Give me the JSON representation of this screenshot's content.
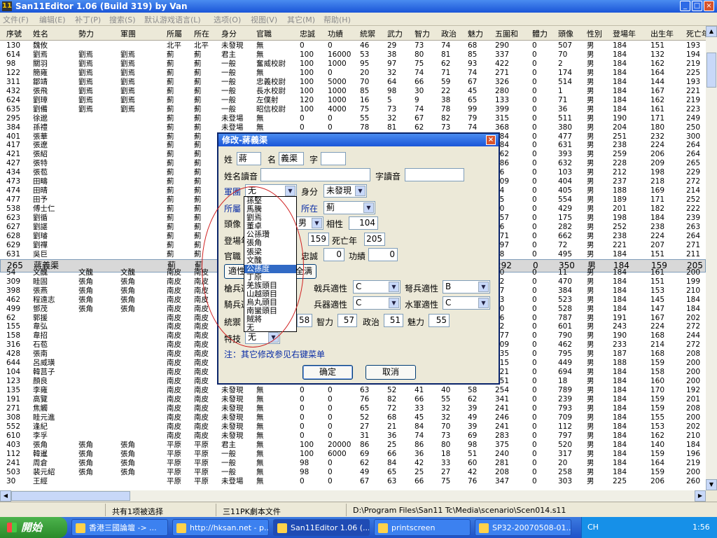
{
  "window": {
    "title": "San11Editor 1.06 (Build 319) by Van",
    "minimize": "_",
    "maximize": "□",
    "close": "×",
    "icon_label": "11"
  },
  "menu": [
    "文件(F)",
    "编辑(E)",
    "补丁(P)",
    "搜索(S)",
    "默认游戏语言(L)",
    "选项(O)",
    "视图(V)",
    "其它(M)",
    "帮助(H)"
  ],
  "grid": {
    "columns": [
      "序號",
      "姓名",
      "勢力",
      "軍團",
      "所屬",
      "所在",
      "身分",
      "官職",
      "忠誠",
      "功績",
      "統禦",
      "武力",
      "智力",
      "政治",
      "魅力",
      "五圍和",
      "體力",
      "頭像",
      "性別",
      "登場年",
      "出生年",
      "死亡年"
    ],
    "rows": [
      [
        "130",
        "魏攸",
        "",
        "",
        "北平",
        "北平",
        "未發現",
        "無",
        "0",
        "0",
        "46",
        "29",
        "73",
        "74",
        "68",
        "290",
        "0",
        "507",
        "男",
        "184",
        "151",
        "193"
      ],
      [
        "614",
        "劉焉",
        "劉焉",
        "劉焉",
        "薊",
        "薊",
        "君主",
        "無",
        "100",
        "16000",
        "53",
        "38",
        "80",
        "81",
        "85",
        "337",
        "0",
        "70",
        "男",
        "184",
        "132",
        "194"
      ],
      [
        "98",
        "關羽",
        "劉焉",
        "劉焉",
        "薊",
        "薊",
        "一般",
        "奮威校尉",
        "100",
        "1000",
        "95",
        "97",
        "75",
        "62",
        "93",
        "422",
        "0",
        "2",
        "男",
        "184",
        "162",
        "219"
      ],
      [
        "122",
        "簡雍",
        "劉焉",
        "劉焉",
        "薊",
        "薊",
        "一般",
        "無",
        "100",
        "0",
        "20",
        "32",
        "74",
        "71",
        "74",
        "271",
        "0",
        "174",
        "男",
        "184",
        "164",
        "225"
      ],
      [
        "311",
        "鄒靖",
        "劉焉",
        "劉焉",
        "薊",
        "薊",
        "一般",
        "忠義校尉",
        "100",
        "5000",
        "70",
        "64",
        "66",
        "59",
        "67",
        "326",
        "0",
        "514",
        "男",
        "184",
        "144",
        "193"
      ],
      [
        "432",
        "張飛",
        "劉焉",
        "劉焉",
        "薊",
        "薊",
        "一般",
        "長水校尉",
        "100",
        "1000",
        "85",
        "98",
        "30",
        "22",
        "45",
        "280",
        "0",
        "1",
        "男",
        "184",
        "167",
        "221"
      ],
      [
        "624",
        "劉璋",
        "劉焉",
        "劉焉",
        "薊",
        "薊",
        "一般",
        "左僕射",
        "120",
        "1000",
        "16",
        "5",
        "9",
        "38",
        "65",
        "133",
        "0",
        "71",
        "男",
        "184",
        "162",
        "219"
      ],
      [
        "635",
        "劉備",
        "劉焉",
        "劉焉",
        "薊",
        "薊",
        "一般",
        "昭信校尉",
        "100",
        "4000",
        "75",
        "73",
        "74",
        "78",
        "99",
        "399",
        "0",
        "36",
        "男",
        "184",
        "161",
        "223"
      ],
      [
        "295",
        "徐邈",
        "",
        "",
        "薊",
        "薊",
        "未登場",
        "無",
        "0",
        "0",
        "55",
        "32",
        "67",
        "82",
        "79",
        "315",
        "0",
        "511",
        "男",
        "190",
        "171",
        "249"
      ],
      [
        "384",
        "孫禮",
        "",
        "",
        "薊",
        "薊",
        "未登場",
        "無",
        "0",
        "0",
        "78",
        "81",
        "62",
        "73",
        "74",
        "368",
        "0",
        "380",
        "男",
        "204",
        "180",
        "250"
      ],
      [
        "401",
        "張華",
        "",
        "",
        "薊",
        "薊",
        "",
        "",
        "",
        "",
        "",
        "",
        "",
        "",
        "",
        "184",
        "0",
        "477",
        "男",
        "251",
        "232",
        "300"
      ],
      [
        "417",
        "張遼",
        "",
        "",
        "薊",
        "薊",
        "",
        "",
        "",
        "",
        "",
        "",
        "",
        "",
        "",
        "184",
        "0",
        "631",
        "男",
        "238",
        "224",
        "264"
      ],
      [
        "421",
        "張紹",
        "",
        "",
        "薊",
        "薊",
        "",
        "",
        "",
        "",
        "",
        "",
        "",
        "",
        "",
        "162",
        "0",
        "393",
        "男",
        "259",
        "206",
        "264"
      ],
      [
        "427",
        "張特",
        "",
        "",
        "薊",
        "薊",
        "",
        "",
        "",
        "",
        "",
        "",
        "",
        "",
        "",
        "186",
        "0",
        "632",
        "男",
        "228",
        "209",
        "265"
      ],
      [
        "434",
        "張苞",
        "",
        "",
        "薊",
        "薊",
        "",
        "",
        "",
        "",
        "",
        "",
        "",
        "",
        "",
        "36",
        "0",
        "103",
        "男",
        "212",
        "198",
        "229"
      ],
      [
        "473",
        "田疇",
        "",
        "",
        "薊",
        "薊",
        "",
        "",
        "",
        "",
        "",
        "",
        "",
        "",
        "",
        "309",
        "0",
        "404",
        "男",
        "237",
        "218",
        "272"
      ],
      [
        "474",
        "田晴",
        "",
        "",
        "薊",
        "薊",
        "",
        "",
        "",
        "",
        "",
        "",
        "",
        "",
        "",
        "64",
        "0",
        "405",
        "男",
        "188",
        "169",
        "214"
      ],
      [
        "477",
        "田予",
        "",
        "",
        "薊",
        "薊",
        "",
        "",
        "",
        "",
        "",
        "",
        "",
        "",
        "",
        "55",
        "0",
        "554",
        "男",
        "189",
        "171",
        "252"
      ],
      [
        "538",
        "傅士仁",
        "",
        "",
        "薊",
        "薊",
        "",
        "",
        "",
        "",
        "",
        "",
        "",
        "",
        "",
        "90",
        "0",
        "429",
        "男",
        "201",
        "182",
        "222"
      ],
      [
        "623",
        "劉循",
        "",
        "",
        "薊",
        "薊",
        "",
        "",
        "",
        "",
        "",
        "",
        "",
        "",
        "",
        "157",
        "0",
        "175",
        "男",
        "198",
        "184",
        "239"
      ],
      [
        "627",
        "劉諶",
        "",
        "",
        "薊",
        "薊",
        "",
        "",
        "",
        "",
        "",
        "",
        "",
        "",
        "",
        "46",
        "0",
        "282",
        "男",
        "252",
        "238",
        "263"
      ],
      [
        "628",
        "劉璿",
        "",
        "",
        "薊",
        "薊",
        "",
        "",
        "",
        "",
        "",
        "",
        "",
        "",
        "",
        "171",
        "0",
        "662",
        "男",
        "238",
        "224",
        "264"
      ],
      [
        "629",
        "劉禪",
        "",
        "",
        "薊",
        "薊",
        "",
        "",
        "",
        "",
        "",
        "",
        "",
        "",
        "",
        "297",
        "0",
        "72",
        "男",
        "221",
        "207",
        "271"
      ],
      [
        "631",
        "吳巨",
        "",
        "",
        "薊",
        "薊",
        "",
        "",
        "",
        "",
        "",
        "",
        "",
        "",
        "",
        "88",
        "0",
        "495",
        "男",
        "184",
        "151",
        "211"
      ],
      [
        "265",
        "蔣義渠",
        "",
        "",
        "薊",
        "薊",
        "",
        "",
        "",
        "",
        "",
        "",
        "",
        "",
        "",
        "292",
        "0",
        "350",
        "男",
        "184",
        "159",
        "205"
      ],
      [
        "54",
        "文醜",
        "文醜",
        "文醜",
        "南皮",
        "南皮",
        "",
        "",
        "",
        "",
        "",
        "",
        "",
        "",
        "",
        "50",
        "0",
        "11",
        "男",
        "184",
        "161",
        "200"
      ],
      [
        "309",
        "眭固",
        "張角",
        "張角",
        "南皮",
        "南皮",
        "",
        "",
        "",
        "",
        "",
        "",
        "",
        "",
        "",
        "12",
        "0",
        "470",
        "男",
        "184",
        "151",
        "199"
      ],
      [
        "398",
        "張燕",
        "張角",
        "張角",
        "南皮",
        "南皮",
        "",
        "",
        "",
        "",
        "",
        "",
        "",
        "",
        "",
        "27",
        "0",
        "384",
        "男",
        "184",
        "153",
        "210"
      ],
      [
        "462",
        "程遠志",
        "張角",
        "張角",
        "南皮",
        "南皮",
        "",
        "",
        "",
        "",
        "",
        "",
        "",
        "",
        "",
        "23",
        "0",
        "523",
        "男",
        "184",
        "145",
        "184"
      ],
      [
        "499",
        "鄧茂",
        "張角",
        "張角",
        "南皮",
        "南皮",
        "",
        "",
        "",
        "",
        "",
        "",
        "",
        "",
        "",
        "10",
        "0",
        "528",
        "男",
        "184",
        "147",
        "184"
      ],
      [
        "62",
        "郭援",
        "",
        "",
        "南皮",
        "南皮",
        "",
        "",
        "",
        "",
        "",
        "",
        "",
        "",
        "",
        "56",
        "0",
        "787",
        "男",
        "191",
        "167",
        "202"
      ],
      [
        "155",
        "韋弘",
        "",
        "",
        "南皮",
        "南皮",
        "",
        "",
        "",
        "",
        "",
        "",
        "",
        "",
        "",
        "82",
        "0",
        "601",
        "男",
        "243",
        "224",
        "272"
      ],
      [
        "158",
        "韋招",
        "",
        "",
        "南皮",
        "南皮",
        "",
        "",
        "",
        "",
        "",
        "",
        "",
        "",
        "",
        "277",
        "0",
        "790",
        "男",
        "190",
        "168",
        "244"
      ],
      [
        "316",
        "石苞",
        "",
        "",
        "南皮",
        "南皮",
        "",
        "",
        "",
        "",
        "",
        "",
        "",
        "",
        "",
        "309",
        "0",
        "462",
        "男",
        "233",
        "214",
        "272"
      ],
      [
        "428",
        "張南",
        "",
        "",
        "南皮",
        "南皮",
        "",
        "",
        "",
        "",
        "",
        "",
        "",
        "",
        "",
        "235",
        "0",
        "795",
        "男",
        "187",
        "168",
        "208"
      ],
      [
        "644",
        "呂威璜",
        "",
        "",
        "南皮",
        "南皮",
        "",
        "",
        "",
        "",
        "",
        "",
        "",
        "",
        "",
        "215",
        "0",
        "449",
        "男",
        "188",
        "159",
        "200"
      ],
      [
        "104",
        "韓莒子",
        "",
        "",
        "南皮",
        "南皮",
        "",
        "",
        "",
        "",
        "",
        "",
        "",
        "",
        "",
        "221",
        "0",
        "694",
        "男",
        "184",
        "158",
        "200"
      ],
      [
        "123",
        "顏良",
        "",
        "",
        "南皮",
        "南皮",
        "",
        "",
        "",
        "",
        "",
        "",
        "",
        "",
        "",
        "251",
        "0",
        "18",
        "男",
        "184",
        "160",
        "200"
      ],
      [
        "135",
        "李雍",
        "",
        "",
        "南皮",
        "南皮",
        "未發現",
        "無",
        "0",
        "0",
        "63",
        "52",
        "41",
        "40",
        "58",
        "254",
        "0",
        "789",
        "男",
        "184",
        "170",
        "192"
      ],
      [
        "191",
        "高覽",
        "",
        "",
        "南皮",
        "南皮",
        "未發現",
        "無",
        "0",
        "0",
        "76",
        "82",
        "66",
        "55",
        "62",
        "341",
        "0",
        "239",
        "男",
        "184",
        "159",
        "201"
      ],
      [
        "271",
        "焦觸",
        "",
        "",
        "南皮",
        "南皮",
        "未發現",
        "無",
        "0",
        "0",
        "65",
        "72",
        "33",
        "32",
        "39",
        "241",
        "0",
        "793",
        "男",
        "184",
        "159",
        "208"
      ],
      [
        "308",
        "眭元進",
        "",
        "",
        "南皮",
        "南皮",
        "未發現",
        "無",
        "0",
        "0",
        "52",
        "68",
        "45",
        "32",
        "49",
        "246",
        "0",
        "709",
        "男",
        "184",
        "155",
        "200"
      ],
      [
        "552",
        "逢紀",
        "",
        "",
        "南皮",
        "南皮",
        "未發現",
        "無",
        "0",
        "0",
        "27",
        "21",
        "84",
        "70",
        "39",
        "241",
        "0",
        "112",
        "男",
        "184",
        "153",
        "202"
      ],
      [
        "610",
        "李孚",
        "",
        "",
        "南皮",
        "南皮",
        "未發現",
        "無",
        "0",
        "0",
        "31",
        "36",
        "74",
        "73",
        "69",
        "283",
        "0",
        "797",
        "男",
        "184",
        "162",
        "210"
      ],
      [
        "403",
        "張角",
        "張角",
        "張角",
        "平原",
        "平原",
        "君主",
        "無",
        "100",
        "20000",
        "86",
        "25",
        "86",
        "80",
        "98",
        "375",
        "0",
        "520",
        "男",
        "184",
        "140",
        "184"
      ],
      [
        "112",
        "韓暹",
        "張角",
        "張角",
        "平原",
        "平原",
        "一般",
        "無",
        "100",
        "6000",
        "69",
        "66",
        "36",
        "18",
        "51",
        "240",
        "0",
        "317",
        "男",
        "184",
        "159",
        "196"
      ],
      [
        "241",
        "周倉",
        "張角",
        "張角",
        "平原",
        "平原",
        "一般",
        "無",
        "98",
        "0",
        "62",
        "84",
        "42",
        "33",
        "60",
        "281",
        "0",
        "20",
        "男",
        "184",
        "164",
        "219"
      ],
      [
        "503",
        "裴元紹",
        "張角",
        "張角",
        "平原",
        "平原",
        "一般",
        "無",
        "98",
        "0",
        "49",
        "65",
        "25",
        "27",
        "42",
        "208",
        "0",
        "258",
        "男",
        "184",
        "159",
        "200"
      ],
      [
        "30",
        "王經",
        "",
        "",
        "平原",
        "平原",
        "未登場",
        "無",
        "0",
        "0",
        "67",
        "63",
        "66",
        "75",
        "76",
        "347",
        "0",
        "303",
        "男",
        "225",
        "206",
        "260"
      ]
    ],
    "selected_row": 24
  },
  "status": {
    "selection": "共有1项被选择",
    "type": "三11PK劇本文件",
    "path": "D:\\Program Files\\San11 Tc\\Media\\scenario\\Scen014.s11"
  },
  "taskbar": {
    "start": "開始",
    "items": [
      "香港三國論壇 -> ...",
      "http://hksan.net - p...",
      "San11Editor 1.06 (...",
      "printscreen",
      "SP32-20070508-01..."
    ],
    "lang": "CH",
    "clock": "1:56"
  },
  "dialog": {
    "title": "修改-蔣義渠",
    "close": "×",
    "labels": {
      "surname": "姓",
      "given": "名",
      "style": "字",
      "name_reading": "姓名讀音",
      "style_reading": "字讀音",
      "corps": "軍團",
      "status": "身分",
      "affiliation": "所屬",
      "location": "所在",
      "portrait": "頭像",
      "appearance": "相性",
      "debut": "登場年",
      "death": "死亡年",
      "office": "官職",
      "loyalty": "忠誠",
      "merit": "功績",
      "spear": "槍兵適性",
      "halberd": "戟兵適性",
      "bow": "弩兵適性",
      "cavalry": "騎兵適性",
      "weapon": "兵器適性",
      "navy": "水軍適性",
      "command": "統禦",
      "intellect": "智力",
      "politics": "政治",
      "charisma": "魅力",
      "skill": "特技",
      "aptitude_btn": "適性",
      "all_btn": "全满"
    },
    "values": {
      "surname": "蔣",
      "given": "義渠",
      "style": "",
      "name_reading": "",
      "style_reading": "",
      "corps": "无",
      "status": "未發現",
      "location": "薊",
      "gender": "男",
      "appearance": "104",
      "debut": "159",
      "death": "205",
      "loyalty": "0",
      "merit": "0",
      "halberd": "C",
      "bow": "B",
      "weapon": "C",
      "navy": "C",
      "command": "58",
      "intellect": "57",
      "politics": "51",
      "charisma": "55",
      "skill": "无"
    },
    "note": "注：其它修改参见右键菜单",
    "ok": "确定",
    "cancel": "取消",
    "dropdown_options": [
      "孫堅",
      "馬騰",
      "劉焉",
      "董卓",
      "公孫瓚",
      "張角",
      "張梁",
      "文醜",
      "公孫度",
      "丁原",
      "羌族頭目",
      "山越頭目",
      "烏丸頭目",
      "南蠻頭目",
      "賊將",
      "无"
    ],
    "dropdown_highlight": 8
  },
  "colors": {
    "titlebar": "#1a55d8",
    "selection": "#316ac5",
    "annotation": "#d02020",
    "label_blue": "#0a2da6"
  }
}
